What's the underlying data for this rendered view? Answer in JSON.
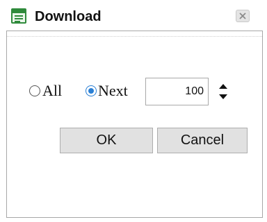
{
  "window": {
    "title": "Download",
    "icon": "document-list-icon",
    "close_icon": "close-icon"
  },
  "options": {
    "all_label": "All",
    "next_label": "Next",
    "selected": "Next"
  },
  "count": {
    "value": "100"
  },
  "buttons": {
    "ok_label": "OK",
    "cancel_label": "Cancel"
  },
  "colors": {
    "icon_green": "#2f8a3b",
    "radio_selected": "#2a7fd4",
    "button_face": "#e1e1e1"
  }
}
